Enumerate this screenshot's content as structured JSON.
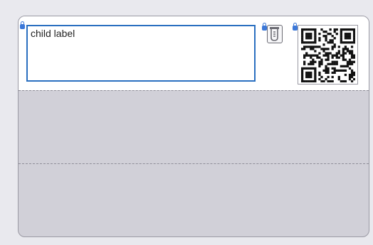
{
  "label": {
    "child_text": "child label"
  },
  "icons": {
    "lock": "lock-icon",
    "tube": "test-tube-icon",
    "qr": "qr-code-icon"
  },
  "colors": {
    "accent_border": "#2a6fc0",
    "lock": "#3c78d8",
    "card_fill": "#d1d0d8"
  }
}
